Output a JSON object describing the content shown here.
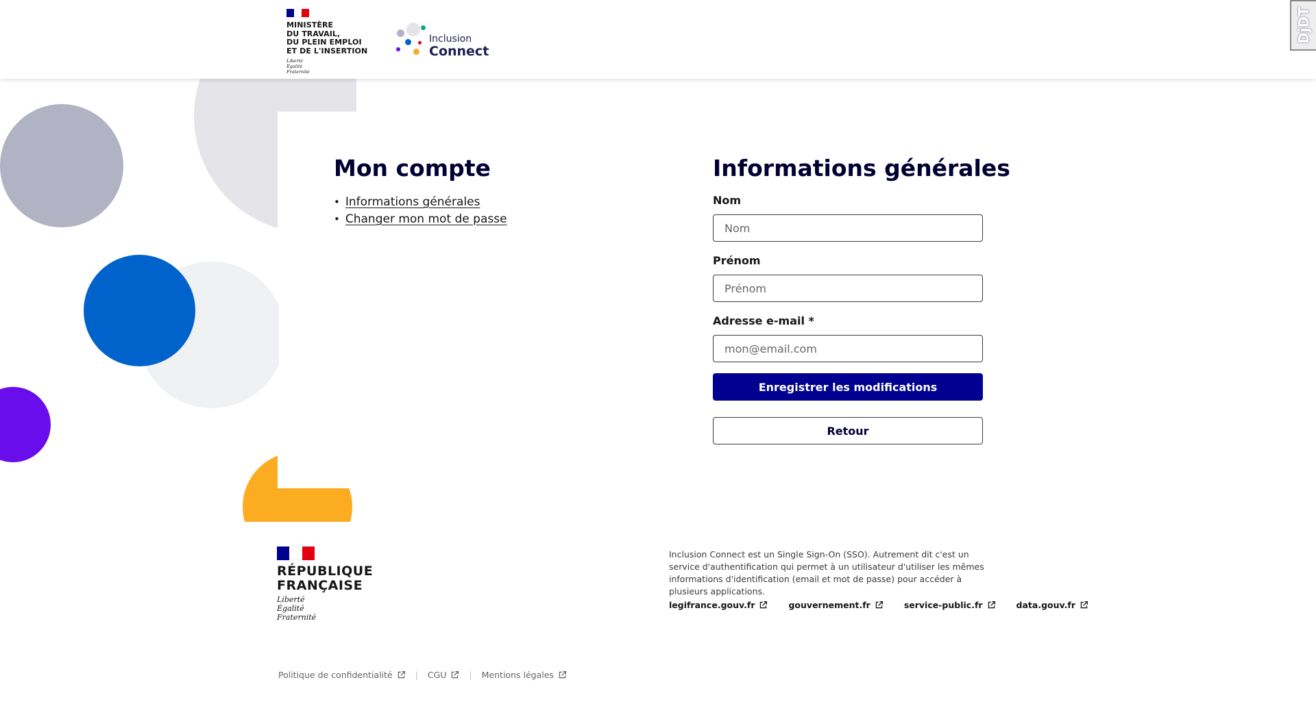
{
  "header": {
    "ministry_lines": [
      "MINISTÈRE",
      "DU TRAVAIL,",
      "DU PLEIN EMPLOI",
      "ET DE L'INSERTION"
    ],
    "ministry_motto": [
      "Liberté",
      "Égalité",
      "Fraternité"
    ],
    "brand_small": "Inclusion",
    "brand_large": "Connect",
    "debug_toolbar": "DjDT"
  },
  "account": {
    "title": "Mon compte",
    "nav": [
      {
        "label": "Informations générales"
      },
      {
        "label": "Changer mon mot de passe"
      }
    ]
  },
  "form": {
    "title": "Informations générales",
    "fields": [
      {
        "label": "Nom",
        "placeholder": "Nom",
        "value": ""
      },
      {
        "label": "Prénom",
        "placeholder": "Prénom",
        "value": ""
      },
      {
        "label": "Adresse e-mail *",
        "placeholder": "mon@email.com",
        "value": ""
      }
    ],
    "submit_label": "Enregistrer les modifications",
    "back_label": "Retour"
  },
  "footer": {
    "republic_lines": [
      "RÉPUBLIQUE",
      "FRANÇAISE"
    ],
    "republic_motto": [
      "Liberté",
      "Égalité",
      "Fraternité"
    ],
    "description": "Inclusion Connect est un Single Sign-On (SSO). Autrement dit c'est un service d'authentification qui permet à un utilisateur d'utiliser les mêmes informations d'identification (email et mot de passe) pour accéder à plusieurs applications.",
    "links": [
      "legifrance.gouv.fr",
      "gouvernement.fr",
      "service-public.fr",
      "data.gouv.fr"
    ],
    "bottom_links": [
      "Politique de confidentialité",
      "CGU",
      "Mentions légales"
    ]
  },
  "colors": {
    "primary": "#000091",
    "title": "#000033",
    "flag_blue": "#000091",
    "flag_red": "#e1000f",
    "deco_grey": "#b1b2c3",
    "deco_blue": "#0063cb",
    "deco_violet": "#6a0dec",
    "deco_green": "#18a37f",
    "deco_yellow": "#fcac20"
  }
}
